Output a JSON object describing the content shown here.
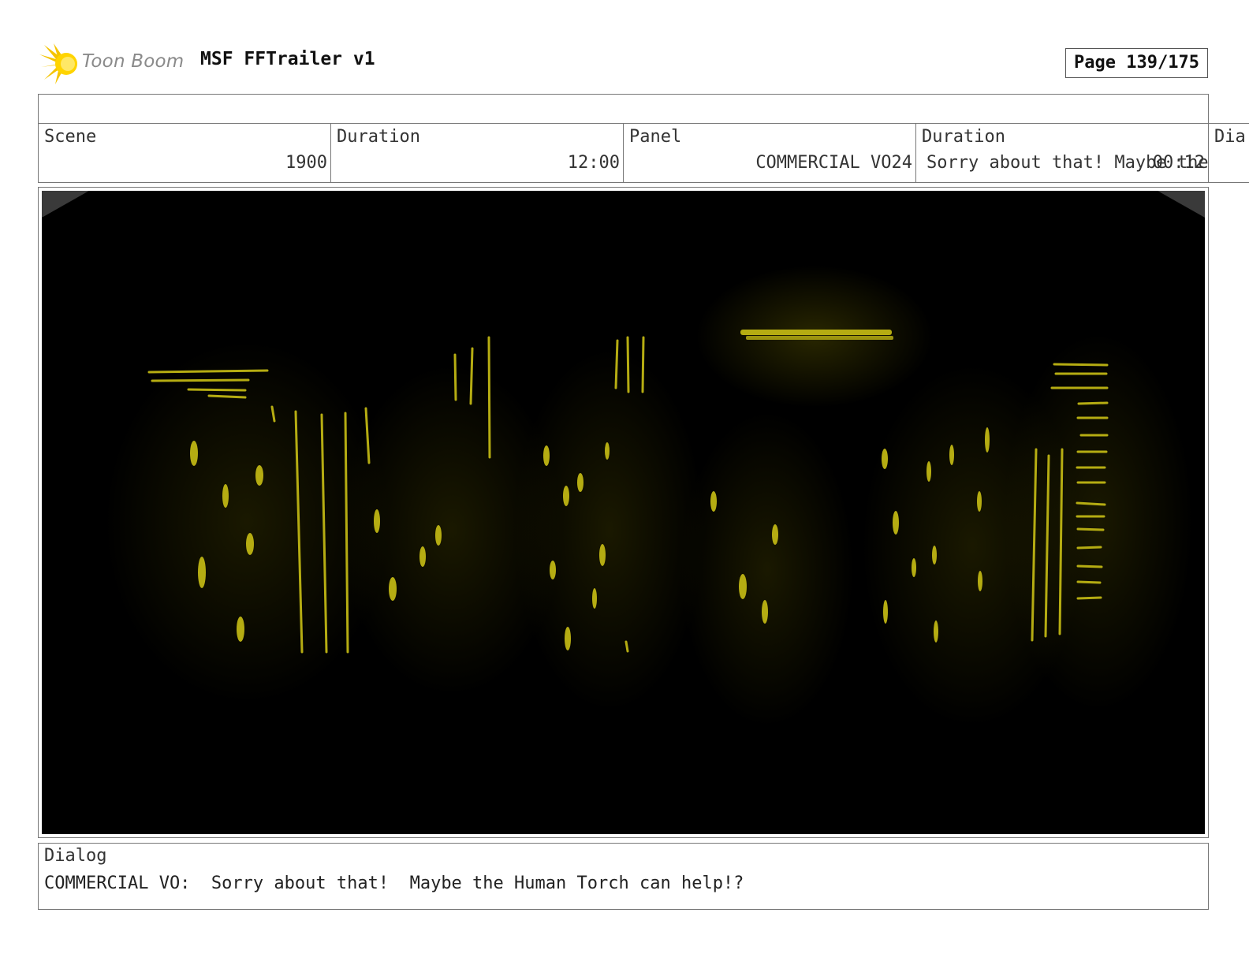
{
  "header": {
    "logo_text": "Toon Boom",
    "project_title": "MSF FFTrailer v1",
    "page_label": "Page 139/175"
  },
  "info": {
    "scene_label": "Scene",
    "scene_value": "1900",
    "duration_label": "Duration",
    "duration_value": "12:00",
    "panel_label": "Panel",
    "panel_value": "COMMERCIAL VO24",
    "panel_duration_label": "Duration",
    "panel_duration_value": "Sorry about that!  Maybe the",
    "panel_duration_extra": "00:12",
    "dialog_col_label": "Dia"
  },
  "dialog": {
    "label": "Dialog",
    "text": "COMMERCIAL VO:  Sorry about that!  Maybe the Human Torch can help!?"
  },
  "colors": {
    "panel_background": "#000000",
    "sketch_yellow": "#b5ac12",
    "glow_yellow": "#4a4600",
    "border_gray": "#777777"
  }
}
